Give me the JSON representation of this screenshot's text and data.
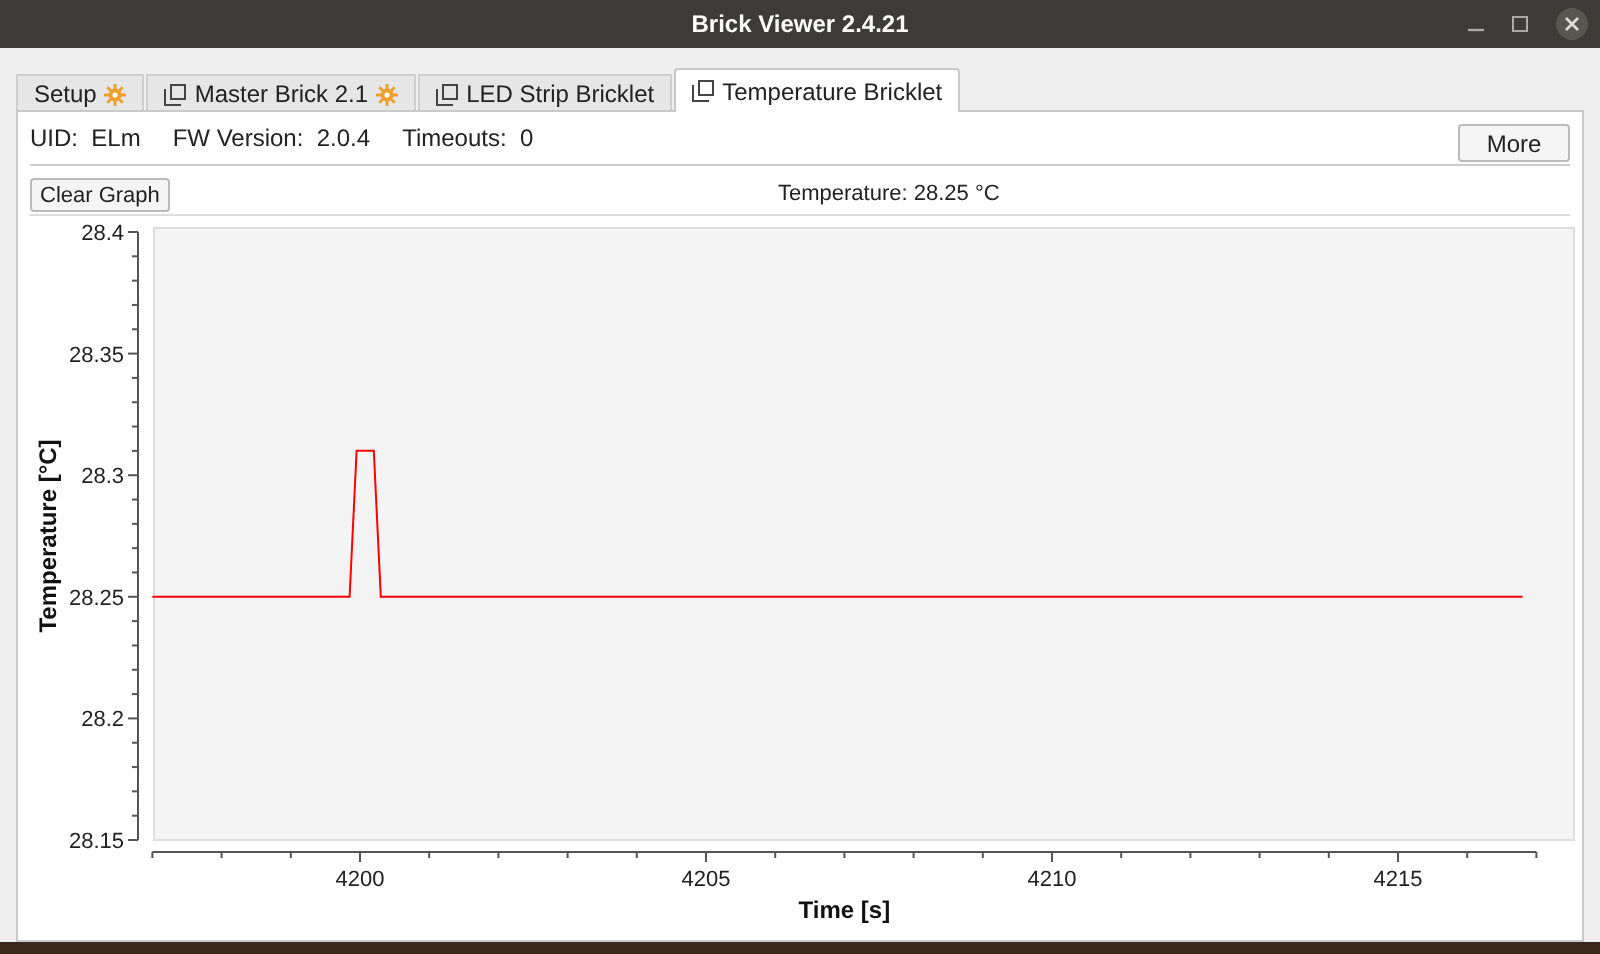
{
  "window": {
    "title": "Brick Viewer 2.4.21"
  },
  "tabs": [
    {
      "label": "Setup",
      "kind": "setup",
      "selected": false
    },
    {
      "label": "Master Brick 2.1",
      "kind": "brick",
      "selected": false
    },
    {
      "label": "LED Strip Bricklet",
      "kind": "bricklet",
      "selected": false
    },
    {
      "label": "Temperature Bricklet",
      "kind": "bricklet",
      "selected": true
    }
  ],
  "info": [
    {
      "label": "UID:",
      "value": "ELm"
    },
    {
      "label": "FW Version:",
      "value": "2.0.4"
    },
    {
      "label": "Timeouts:",
      "value": "0"
    }
  ],
  "more_button": "More",
  "clear_button": "Clear Graph",
  "reading": "Temperature: 28.25 °C",
  "chart_data": {
    "type": "line",
    "xlabel": "Time [s]",
    "ylabel": "Temperature [°C]",
    "xlim": [
      4197,
      4217
    ],
    "ylim": [
      28.15,
      28.4
    ],
    "xticks": [
      4200,
      4205,
      4210,
      4215
    ],
    "yticks": [
      {
        "value": 28.15,
        "label": "28.15"
      },
      {
        "value": 28.2,
        "label": "28.2"
      },
      {
        "value": 28.25,
        "label": "28.25"
      },
      {
        "value": 28.3,
        "label": "28.3"
      },
      {
        "value": 28.35,
        "label": "28.35"
      },
      {
        "value": 28.4,
        "label": "28.4"
      }
    ],
    "x": [
      4197,
      4199.85,
      4199.95,
      4200.2,
      4200.3,
      4216.8
    ],
    "series": [
      {
        "color": "#ff0000",
        "values": [
          28.25,
          28.25,
          28.31,
          28.31,
          28.25,
          28.25
        ]
      }
    ]
  }
}
